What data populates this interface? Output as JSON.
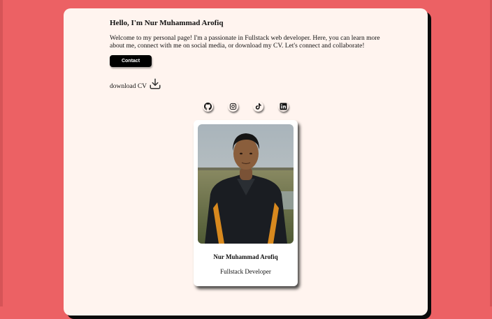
{
  "intro": {
    "greeting": "Hello, I'm Nur Muhammad Arofiq",
    "description": "Welcome to my personal page! I'm a passionate in Fullstack web developer. Here, you can learn more about me, connect with me on social media, or download my CV. Let's connect and collaborate!",
    "contact_label": "Contact",
    "download_label": "download CV"
  },
  "socials": [
    {
      "name": "github",
      "icon": "github-icon"
    },
    {
      "name": "instagram",
      "icon": "instagram-icon"
    },
    {
      "name": "tiktok",
      "icon": "tiktok-icon"
    },
    {
      "name": "linkedin",
      "icon": "linkedin-icon"
    }
  ],
  "profile": {
    "name": "Nur Muhammad Arofiq",
    "role": "Fullstack Developer",
    "photo": "profile-photo"
  },
  "colors": {
    "background": "#ec6164",
    "card": "#fff4ef",
    "button": "#000000"
  }
}
